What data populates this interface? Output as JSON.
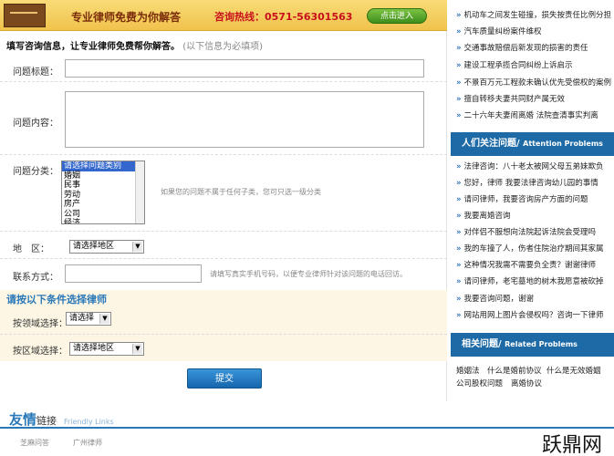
{
  "banner": {
    "title": "专业律师免费为你解答",
    "hotline": "咨询热线：0571-56301563",
    "enter_label": "点击进入"
  },
  "form": {
    "intro_bold": "填写咨询信息，让专业律师免费帮你解答。",
    "intro_note": "(以下信息为必填项)",
    "title_label": "问题标题：",
    "content_label": "问题内容：",
    "category_label": "问题分类：",
    "category_options": [
      "请选择问题类别",
      "婚姻",
      "民事",
      "劳动",
      "房产",
      "公司",
      "经济"
    ],
    "category_hint": "如果您的问题不属于任何子类，您可只选一级分类",
    "region_label": "地　区：",
    "region_value": "请选择地区",
    "contact_label": "联系方式：",
    "contact_hint": "请填写真实手机号码，以便专业律师针对该问题的电话回访。",
    "lawyer_section_title": "请按以下条件选择律师",
    "domain_label": "按领域选择：",
    "domain_value": "请选择",
    "area_label": "按区域选择：",
    "area_value": "请选择地区",
    "submit_label": "提交"
  },
  "sidebar": {
    "top_news": [
      "机动车之间发生碰撞，损失按责任比例分担",
      "汽车质量纠纷案件维权",
      "交通事故赔偿后新发现的损害的责任",
      "建设工程承揽合同纠纷上诉启示",
      "不景百万元工程款未确认优先受偿权的案例",
      "擅自转移夫妻共同财产属无效",
      "二十六年夫妻闹离婚 法院查清事实判离"
    ],
    "focus_title": "人们关注问题",
    "focus_title_en": "Attention Problems",
    "focus_list": [
      "法律咨询：八十老太被网父母五弟妹欺负",
      "您好，律师 我要法律咨询幼儿园的事情",
      "请问律师，我要咨询房产方面的问题",
      "我要离婚咨询",
      "对伴侣不服想向法院起诉法院会受理吗",
      "我的车撞了人，伤者住院治疗期间其家属",
      "这种情况我需不需要负全责？谢谢律师",
      "请问律师，老宅墓地的树木我愿意被砍掉",
      "我要咨询问题，谢谢",
      "网站用网上图片会侵权吗？咨询一下律师"
    ],
    "related_title": "相关问题",
    "related_title_en": "Related Problems",
    "related_tags": [
      "婚姻法",
      "什么是婚前协议",
      "什么是无效婚姻",
      "公司股权问题",
      "离婚协议"
    ]
  },
  "links": {
    "title_big": "友情",
    "title_small": "链接",
    "title_en": "Friendly Links",
    "items": [
      "芝麻问答",
      "广州律师"
    ]
  },
  "watermark": "跃鼎网"
}
